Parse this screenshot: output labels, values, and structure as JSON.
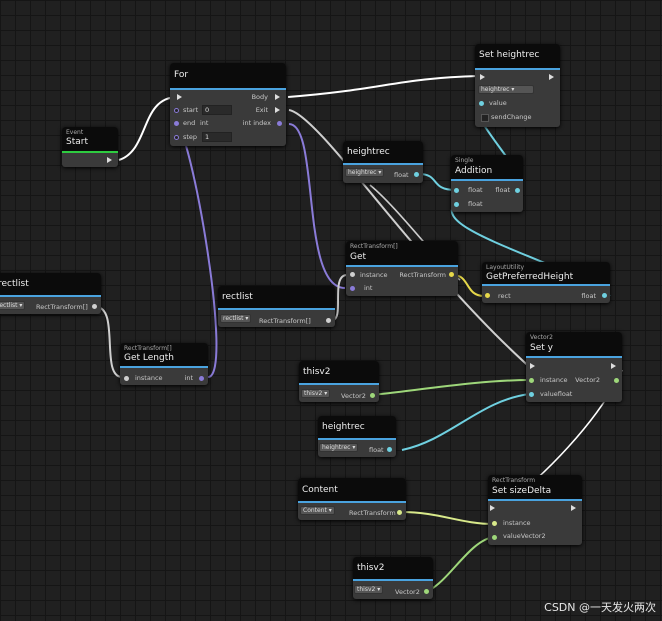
{
  "theme": {
    "accent": "#4aa3df",
    "event_accent": "#2ecc40",
    "line_exec": "#ffffff",
    "line_int": "#8a7bd8",
    "line_float": "#6fd0e0",
    "line_vec2": "#9ed77a",
    "line_rect": "#d0d0d0"
  },
  "nodes": {
    "for_loop": {
      "title": "For",
      "body": "Body",
      "exit": "Exit",
      "start": "start",
      "end": "end",
      "step": "step",
      "start_val": "0",
      "end_type": "int",
      "step_val": "1",
      "index": "int index"
    },
    "event_start": {
      "category": "Event",
      "title": "Start"
    },
    "set_heightrec": {
      "title": "Set heightrec",
      "dropdown": "heightrec",
      "value": "value",
      "send": "sendChange"
    },
    "heightrec_var1": {
      "title": "heightrec",
      "dropdown": "heightrec",
      "out": "float"
    },
    "addition": {
      "category": "Single",
      "title": "Addition",
      "in1": "float",
      "in2": "float",
      "out": "float"
    },
    "get_rect": {
      "category": "RectTransform[]",
      "title": "Get",
      "instance": "instance",
      "int": "int",
      "out": "RectTransform"
    },
    "get_preferred": {
      "category": "LayoutUtility",
      "title": "GetPreferredHeight",
      "rect": "rect",
      "out": "float"
    },
    "rectlist_left": {
      "title": "rectlist",
      "dropdown": "rectlist",
      "out": "RectTransform[]"
    },
    "rectlist_mid": {
      "title": "rectlist",
      "dropdown": "rectlist",
      "out": "RectTransform[]"
    },
    "get_length": {
      "category": "RectTransform[]",
      "title": "Get Length",
      "instance": "instance",
      "out": "int"
    },
    "set_y": {
      "category": "Vector2",
      "title": "Set y",
      "instance": "instance",
      "value": "valuefloat",
      "out": "Vector2"
    },
    "thisv2_a": {
      "title": "thisv2",
      "dropdown": "thisv2",
      "out": "Vector2"
    },
    "heightrec_var2": {
      "title": "heightrec",
      "dropdown": "heightrec",
      "out": "float"
    },
    "content": {
      "title": "Content",
      "dropdown": "Content",
      "out": "RectTransform"
    },
    "set_size": {
      "category": "RectTransform",
      "title": "Set sizeDelta",
      "instance": "instance",
      "value": "valueVector2"
    },
    "thisv2_b": {
      "title": "thisv2",
      "dropdown": "thisv2",
      "out": "Vector2"
    }
  },
  "watermark": "CSDN @一天发火两次"
}
